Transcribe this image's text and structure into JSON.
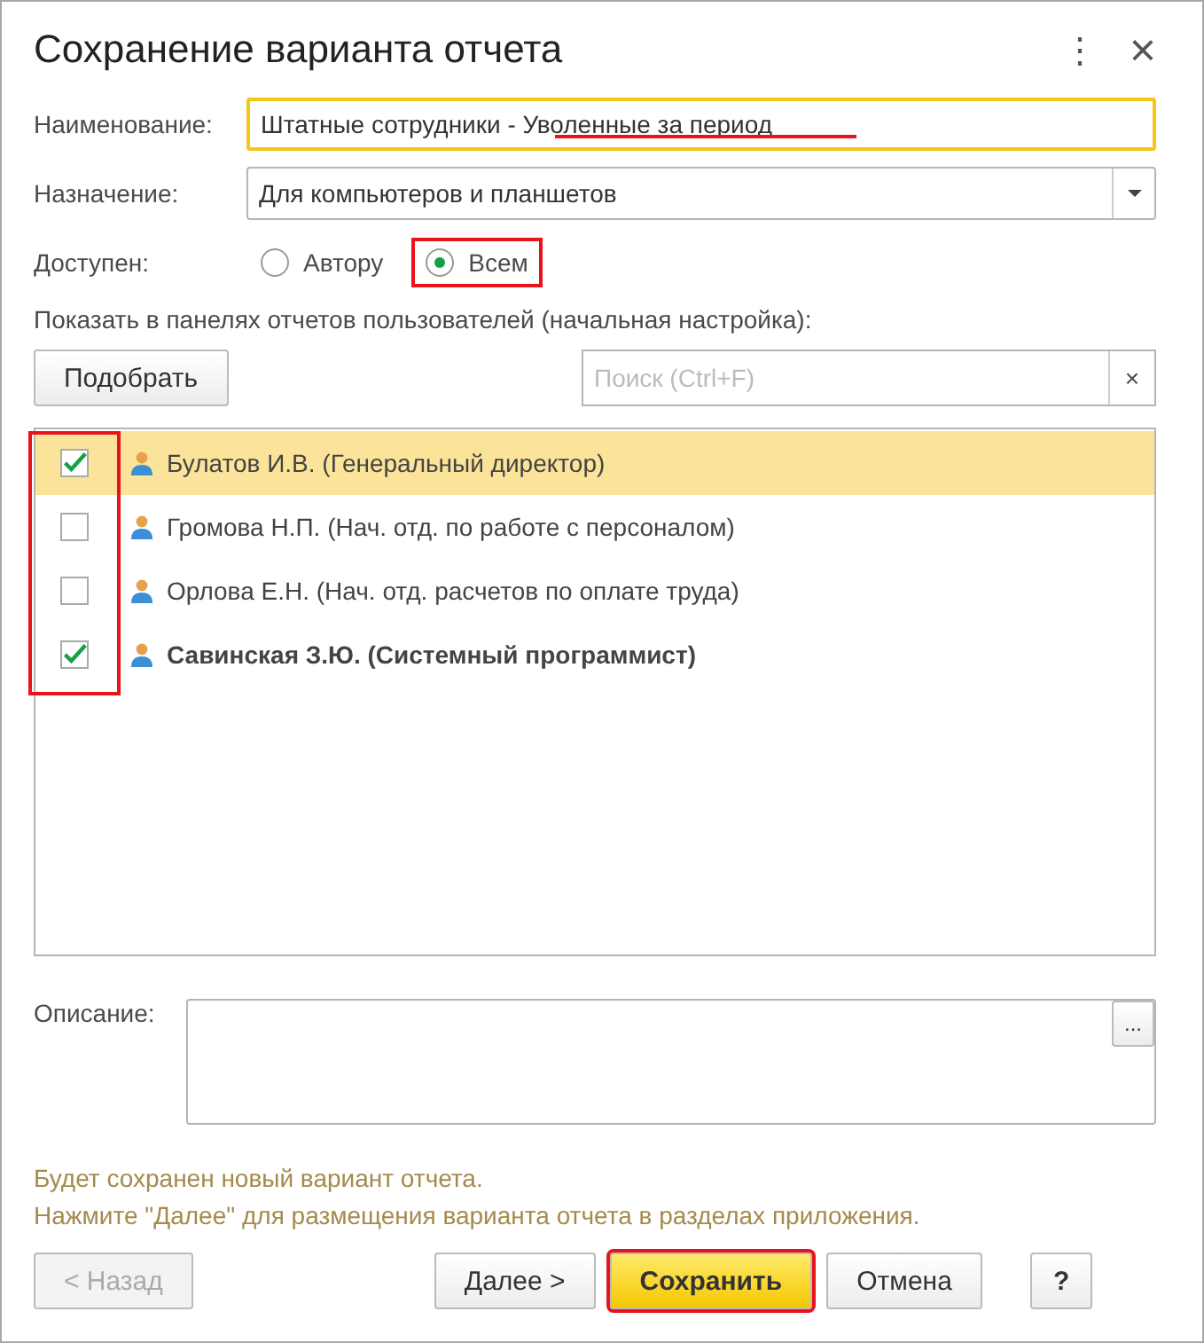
{
  "window": {
    "title": "Сохранение варианта отчета",
    "menu_glyph": "⋮",
    "close_glyph": "×"
  },
  "name_field": {
    "label": "Наименование:",
    "value": "Штатные сотрудники - Уволенные за период",
    "focused": true,
    "annotation_underline": true
  },
  "purpose_field": {
    "label": "Назначение:",
    "value": "Для компьютеров и планшетов"
  },
  "available": {
    "label": "Доступен:",
    "highlighted": true,
    "options": [
      {
        "label": "Автору",
        "selected": false
      },
      {
        "label": "Всем",
        "selected": true
      }
    ]
  },
  "users_section": {
    "label": "Показать в панелях отчетов пользователей (начальная настройка):",
    "pick_button": "Подобрать",
    "search_placeholder": "Поиск (Ctrl+F)",
    "search_clear": "×",
    "checkbox_column_highlighted": true
  },
  "users": [
    {
      "name": "Булатов И.В. (Генеральный директор)",
      "checked": true,
      "selected": true,
      "bold": false
    },
    {
      "name": "Громова Н.П. (Нач. отд. по работе с персоналом)",
      "checked": false,
      "selected": false,
      "bold": false
    },
    {
      "name": "Орлова Е.Н. (Нач. отд. расчетов по оплате труда)",
      "checked": false,
      "selected": false,
      "bold": false
    },
    {
      "name": "Савинская З.Ю. (Системный программист)",
      "checked": true,
      "selected": false,
      "bold": true
    }
  ],
  "description": {
    "label": "Описание:",
    "more_button": "..."
  },
  "info": [
    "Будет сохранен новый вариант отчета.",
    "Нажмите \"Далее\" для размещения варианта отчета в разделах приложения."
  ],
  "buttons": [
    {
      "label": "< Назад",
      "kind": "plain",
      "disabled": true,
      "highlighted": false
    },
    {
      "label": "Далее  >",
      "kind": "plain",
      "disabled": false,
      "highlighted": false
    },
    {
      "label": "Сохранить",
      "kind": "default",
      "disabled": false,
      "highlighted": true
    },
    {
      "label": "Отмена",
      "kind": "plain",
      "disabled": false,
      "highlighted": false
    },
    {
      "label": "?",
      "kind": "help",
      "disabled": false,
      "highlighted": false
    }
  ]
}
